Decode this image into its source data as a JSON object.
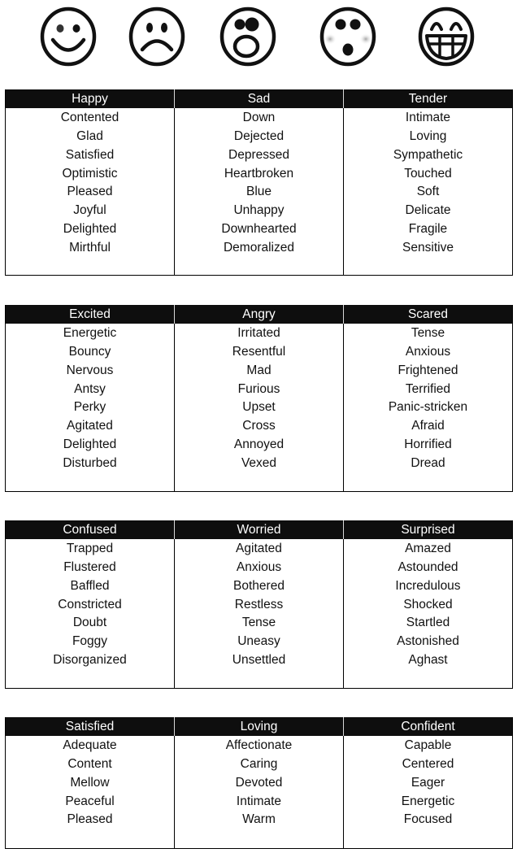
{
  "faces": [
    {
      "name": "happy-face-icon",
      "label": "Happy"
    },
    {
      "name": "sad-face-icon",
      "label": "Sad"
    },
    {
      "name": "shocked-face-icon",
      "label": "Shocked"
    },
    {
      "name": "surprised-blushing-face-icon",
      "label": "Surprised"
    },
    {
      "name": "grinning-face-icon",
      "label": "Grinning"
    }
  ],
  "tables": [
    {
      "columns": [
        {
          "header": "Happy",
          "words": [
            "Contented",
            "Glad",
            "Satisfied",
            "Optimistic",
            "Pleased",
            "Joyful",
            "Delighted",
            "Mirthful"
          ]
        },
        {
          "header": "Sad",
          "words": [
            "Down",
            "Dejected",
            "Depressed",
            "Heartbroken",
            "Blue",
            "Unhappy",
            "Downhearted",
            "Demoralized"
          ]
        },
        {
          "header": "Tender",
          "words": [
            "Intimate",
            "Loving",
            "Sympathetic",
            "Touched",
            "Soft",
            "Delicate",
            "Fragile",
            "Sensitive"
          ]
        }
      ]
    },
    {
      "columns": [
        {
          "header": "Excited",
          "words": [
            "Energetic",
            "Bouncy",
            "Nervous",
            "Antsy",
            "Perky",
            "Agitated",
            "Delighted",
            "Disturbed"
          ]
        },
        {
          "header": "Angry",
          "words": [
            "Irritated",
            "Resentful",
            "Mad",
            "Furious",
            "Upset",
            "Cross",
            "Annoyed",
            "Vexed"
          ]
        },
        {
          "header": "Scared",
          "words": [
            "Tense",
            "Anxious",
            "Frightened",
            "Terrified",
            "Panic-stricken",
            "Afraid",
            "Horrified",
            "Dread"
          ]
        }
      ]
    },
    {
      "columns": [
        {
          "header": "Confused",
          "words": [
            "Trapped",
            "Flustered",
            "Baffled",
            "Constricted",
            "Doubt",
            "Foggy",
            "Disorganized"
          ]
        },
        {
          "header": "Worried",
          "words": [
            "Agitated",
            "Anxious",
            "Bothered",
            "Restless",
            "Tense",
            "Uneasy",
            "Unsettled"
          ]
        },
        {
          "header": "Surprised",
          "words": [
            "Amazed",
            "Astounded",
            "Incredulous",
            "Shocked",
            "Startled",
            "Astonished",
            "Aghast"
          ]
        }
      ]
    },
    {
      "columns": [
        {
          "header": "Satisfied",
          "words": [
            "Adequate",
            "Content",
            "Mellow",
            "Peaceful",
            "Pleased"
          ]
        },
        {
          "header": "Loving",
          "words": [
            "Affectionate",
            "Caring",
            "Devoted",
            "Intimate",
            "Warm"
          ]
        },
        {
          "header": "Confident",
          "words": [
            "Capable",
            "Centered",
            "Eager",
            "Energetic",
            "Focused"
          ]
        }
      ]
    }
  ]
}
